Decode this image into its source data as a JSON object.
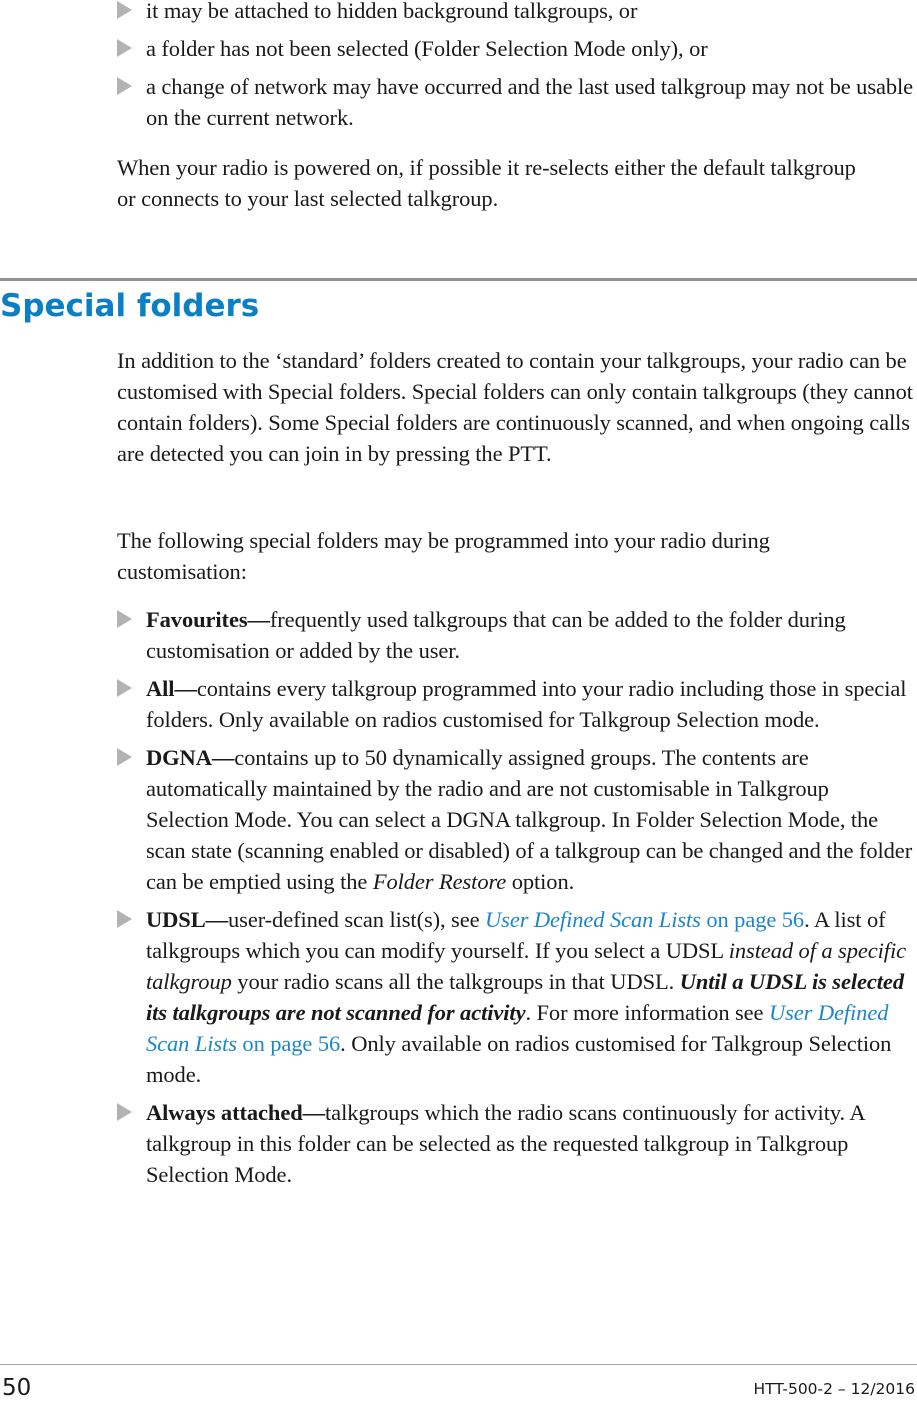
{
  "top_list": {
    "items": [
      {
        "text": "it may be attached to hidden background talkgroups, or"
      },
      {
        "text": "a folder has not been selected (Folder Selection Mode only), or"
      },
      {
        "text": "a change of network may have occurred and the last used talkgroup may not be usable on the current network."
      }
    ]
  },
  "power_on_paragraph": "When your radio is powered on, if possible it re-selects either the default talkgroup or connects to your last selected talkgroup.",
  "section": {
    "title": "Special folders",
    "intro": "In addition to the ‘standard’ folders created to contain your talkgroups, your radio can be customised with Special folders. Special folders can only contain talkgroups (they cannot contain folders). Some Special folders are continuously scanned, and when ongoing calls are detected you can join in by pressing the PTT.",
    "lead_in": "The following special folders may be programmed into your radio during customisation:",
    "folders": [
      {
        "term": "Favourites",
        "separator": "—",
        "desc": "frequently used talkgroups that can be added to the folder during customisation or added by the user."
      },
      {
        "term": "All",
        "separator": "—",
        "desc": "contains every talkgroup programmed into your radio including those in special folders. Only available on radios customised for Talkgroup Selection mode."
      },
      {
        "term": "DGNA",
        "separator": "—",
        "desc_before_em": "contains up to 50 dynamically assigned groups. The contents are automatically maintained by the radio and are not customisable in Talkgroup Selection Mode. You can select a DGNA talkgroup. In Folder Selection Mode, the scan state (scanning enabled or disabled) of a talkgroup can be changed and the folder can be emptied using the ",
        "em": "Folder Restore",
        "desc_after_em": " option."
      },
      {
        "term": "UDSL",
        "separator": "—",
        "part1": "user-defined scan list(s), see ",
        "link1_title": "User Defined Scan Lists",
        "link1_page": " on page 56",
        "part2": ". A list of talkgroups which you can modify yourself. If you select a UDSL ",
        "em": "instead of a specific talkgroup",
        "part3": " your radio scans all the talkgroups in that UDSL. ",
        "strong_em": "Until a UDSL is selected its talkgroups are not scanned for activity",
        "part4": ". For more information see ",
        "link2_title": "User Defined Scan Lists",
        "link2_page": " on page 56",
        "part5": ". Only available on radios customised for Talkgroup Selection mode."
      },
      {
        "term": "Always attached",
        "separator": "—",
        "desc": "talkgroups which the radio scans continuously for activity. A talkgroup in this folder can be selected as the requested talkgroup in Talkgroup Selection Mode."
      }
    ]
  },
  "footer": {
    "page_number": "50",
    "doc_id": "HTT-500-2 – 12/2016"
  },
  "colors": {
    "heading": "#0a7fc6",
    "link": "#1c86c8",
    "bullet": "#b3b3b3",
    "rule": "#939393"
  }
}
